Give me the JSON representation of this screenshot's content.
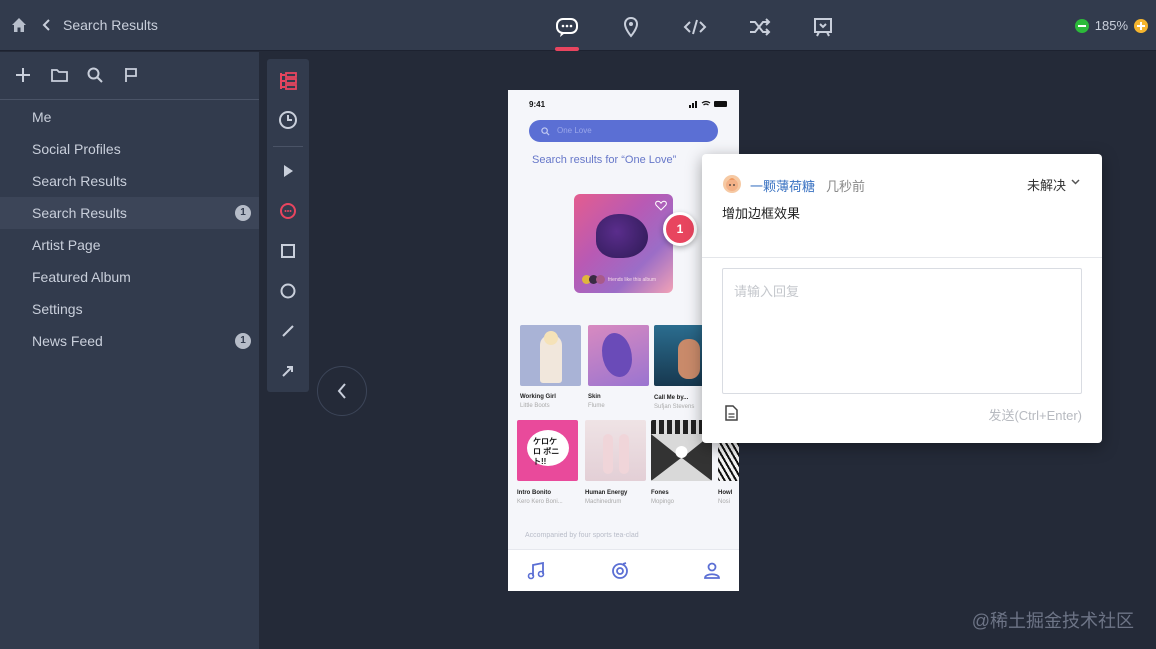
{
  "header": {
    "title": "Search Results",
    "zoom": "185%",
    "tabs": [
      "comment-icon",
      "location-icon",
      "code-icon",
      "shuffle-icon",
      "flag-screen-icon"
    ],
    "active_tab": "comment-icon"
  },
  "sidebar": {
    "items": [
      {
        "label": "Me",
        "badge": ""
      },
      {
        "label": "Social Profiles",
        "badge": ""
      },
      {
        "label": "Search Results",
        "badge": ""
      },
      {
        "label": "Search Results",
        "badge": "1",
        "active": true
      },
      {
        "label": "Artist Page",
        "badge": ""
      },
      {
        "label": "Featured Album",
        "badge": ""
      },
      {
        "label": "Settings",
        "badge": ""
      },
      {
        "label": "News Feed",
        "badge": "1"
      }
    ]
  },
  "phone": {
    "status_time": "9:41",
    "search_placeholder": "One Love",
    "heading": "Search results for “One Love”",
    "album_caption": "friends like this album",
    "pin_number": "1",
    "tiles": [
      {
        "name": "Working Girl",
        "sub": "Little Boots"
      },
      {
        "name": "Skin",
        "sub": "Flume"
      },
      {
        "name": "Call Me by...",
        "sub": "Sufjan Stevens"
      },
      {
        "name": "Intro Bonito",
        "sub": "Kero Kero Boni..."
      },
      {
        "name": "Human Energy",
        "sub": "Machinedrum"
      },
      {
        "name": "Fones",
        "sub": "Mopingo"
      },
      {
        "name": "Howl",
        "sub": "Nosi"
      }
    ],
    "tile4_text": "ケロケロ ボニト!!",
    "footer_text": "Accompanied by four sports tea-clad"
  },
  "popup": {
    "user": "一颗薄荷糖",
    "time": "几秒前",
    "status": "未解决",
    "comment": "增加边框效果",
    "reply_placeholder": "请输入回复",
    "send_label": "发送(Ctrl+Enter)"
  },
  "colors": {
    "accent": "#e8455f",
    "brand_blue": "#5b6fd4",
    "panel": "#323b4d",
    "canvas": "#242a38"
  },
  "watermark": "@稀土掘金技术社区"
}
